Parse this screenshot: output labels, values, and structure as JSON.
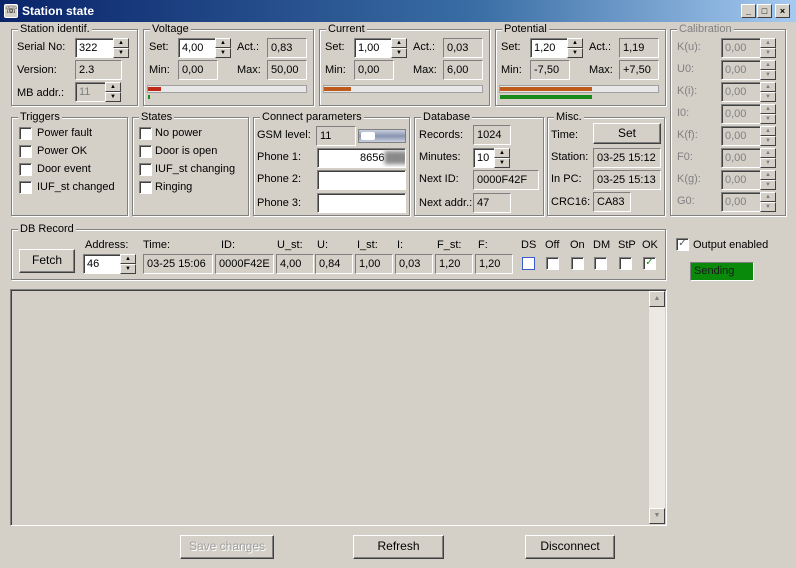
{
  "window": {
    "title": "Station state",
    "min_label": "_",
    "max_label": "□",
    "close_label": "×"
  },
  "station": {
    "legend": "Station identif.",
    "serial_label": "Serial No:",
    "serial_value": "322",
    "version_label": "Version:",
    "version_value": "2.3",
    "mb_label": "MB addr.:",
    "mb_value": "11"
  },
  "voltage": {
    "legend": "Voltage",
    "set_label": "Set:",
    "set_value": "4,00",
    "act_label": "Act.:",
    "act_value": "0,83",
    "min_label": "Min:",
    "min_value": "0,00",
    "max_label": "Max:",
    "max_value": "50,00",
    "red_fraction": 0.08,
    "green_fraction": 0.01
  },
  "current": {
    "legend": "Current",
    "set_label": "Set:",
    "set_value": "1,00",
    "act_label": "Act.:",
    "act_value": "0,03",
    "min_label": "Min:",
    "min_value": "0,00",
    "max_label": "Max:",
    "max_value": "6,00",
    "red_fraction": 0.17,
    "green_fraction": 0.0
  },
  "potential": {
    "legend": "Potential",
    "set_label": "Set:",
    "set_value": "1,20",
    "act_label": "Act.:",
    "act_value": "1,19",
    "min_label": "Min:",
    "min_value": "-7,50",
    "max_label": "Max:",
    "max_value": "+7,50",
    "red_fraction": 0.58,
    "green_fraction": 0.58
  },
  "calibration": {
    "legend": "Calibration",
    "rows": [
      {
        "label": "K(u):",
        "value": "0,00"
      },
      {
        "label": "U0:",
        "value": "0,00"
      },
      {
        "label": "K(i):",
        "value": "0,00"
      },
      {
        "label": "I0:",
        "value": "0,00"
      },
      {
        "label": "K(f):",
        "value": "0,00"
      },
      {
        "label": "F0:",
        "value": "0,00"
      },
      {
        "label": "K(g):",
        "value": "0,00"
      },
      {
        "label": "G0:",
        "value": "0,00"
      }
    ]
  },
  "triggers": {
    "legend": "Triggers",
    "items": [
      "Power fault",
      "Power OK",
      "Door event",
      "IUF_st changed"
    ]
  },
  "states": {
    "legend": "States",
    "items": [
      "No power",
      "Door is open",
      "IUF_st changing",
      "Ringing"
    ]
  },
  "connect": {
    "legend": "Connect parameters",
    "gsm_label": "GSM level:",
    "gsm_value": "11",
    "phone1_label": "Phone 1:",
    "phone1_value": "8656",
    "phone2_label": "Phone 2:",
    "phone2_value": "",
    "phone3_label": "Phone 3:",
    "phone3_value": ""
  },
  "database": {
    "legend": "Database",
    "records_label": "Records:",
    "records_value": "1024",
    "minutes_label": "Minutes:",
    "minutes_value": "10",
    "nextid_label": "Next ID:",
    "nextid_value": "0000F42F",
    "nextaddr_label": "Next addr.:",
    "nextaddr_value": "47"
  },
  "misc": {
    "legend": "Misc.",
    "time_label": "Time:",
    "set_button": "Set",
    "station_label": "Station:",
    "station_value": "03-25 15:12",
    "inpc_label": "In PC:",
    "inpc_value": "03-25 15:13",
    "crc_label": "CRC16:",
    "crc_value": "CA83"
  },
  "dbrecord": {
    "legend": "DB Record",
    "fetch_button": "Fetch",
    "address_label": "Address:",
    "address_value": "46",
    "time_label": "Time:",
    "time_value": "03-25 15:06",
    "id_label": "ID:",
    "id_value": "0000F42E",
    "ust_label": "U_st:",
    "ust_value": "4,00",
    "u_label": "U:",
    "u_value": "0,84",
    "ist_label": "I_st:",
    "ist_value": "1,00",
    "i_label": "I:",
    "i_value": "0,03",
    "fst_label": "F_st:",
    "fst_value": "1,20",
    "f_label": "F:",
    "f_value": "1,20",
    "flags": [
      {
        "label": "DS",
        "checked": false
      },
      {
        "label": "Off",
        "checked": false
      },
      {
        "label": "On",
        "checked": false
      },
      {
        "label": "DM",
        "checked": false
      },
      {
        "label": "StP",
        "checked": false
      },
      {
        "label": "OK",
        "checked": true
      }
    ]
  },
  "output": {
    "label": "Output enabled",
    "checked": true,
    "status": "Sending"
  },
  "buttons": {
    "save": "Save changes",
    "refresh": "Refresh",
    "disconnect": "Disconnect"
  },
  "glyphs": {
    "up": "▲",
    "down": "▼",
    "check": "✓"
  }
}
